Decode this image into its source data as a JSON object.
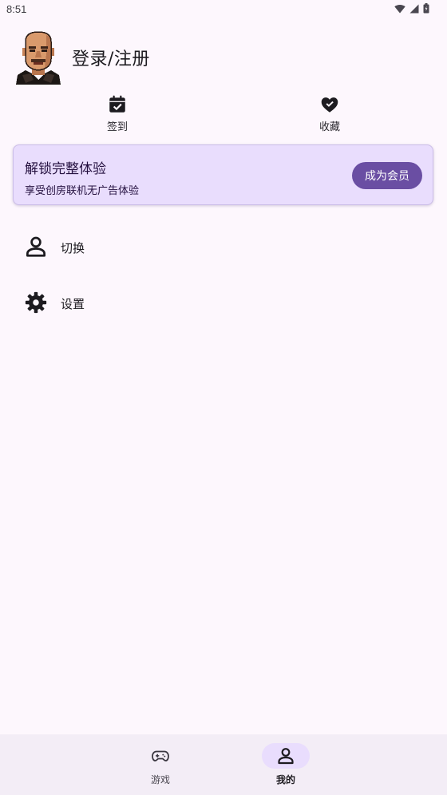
{
  "status_bar": {
    "time": "8:51",
    "icons": [
      "wifi-icon",
      "cell-signal-icon",
      "battery-icon"
    ]
  },
  "profile": {
    "avatar": "pixel-art-bald-man-avatar",
    "login_label": "登录/注册"
  },
  "quick_actions": [
    {
      "icon": "calendar-check-icon",
      "label": "签到"
    },
    {
      "icon": "heart-check-icon",
      "label": "收藏"
    }
  ],
  "vip_card": {
    "title": "解锁完整体验",
    "subtitle": "享受创房联机无广告体验",
    "button_label": "成为会员",
    "colors": {
      "background": "#e9ddfd",
      "button": "#6a4ea3"
    }
  },
  "menu": [
    {
      "icon": "person-icon",
      "label": "切换"
    },
    {
      "icon": "gear-icon",
      "label": "设置"
    }
  ],
  "bottom_nav": {
    "items": [
      {
        "icon": "gamepad-icon",
        "label": "游戏",
        "selected": false
      },
      {
        "icon": "person-icon",
        "label": "我的",
        "selected": true
      }
    ]
  }
}
